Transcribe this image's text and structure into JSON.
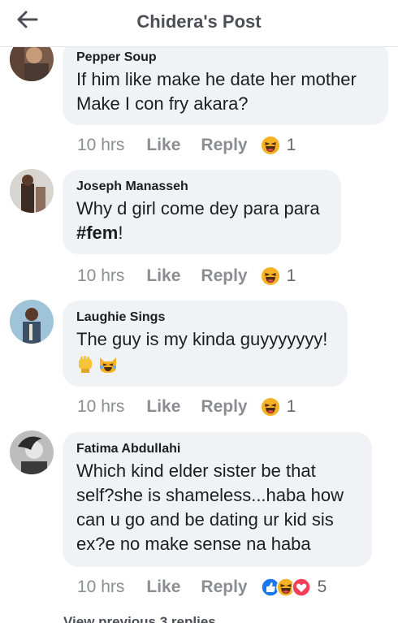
{
  "header": {
    "title": "Chidera's Post"
  },
  "comments": [
    {
      "author": "Pepper Soup",
      "text": "If him like make he date her mother\nMake I con fry akara?",
      "time": "10 hrs",
      "like": "Like",
      "reply": "Reply",
      "reactions": [
        "haha"
      ],
      "reaction_count": "1"
    },
    {
      "author": "Joseph Manasseh",
      "text_pre": "Why d girl come dey para para\n",
      "tag": "#fem",
      "text_post": "!",
      "time": "10 hrs",
      "like": "Like",
      "reply": "Reply",
      "reactions": [
        "haha"
      ],
      "reaction_count": "1"
    },
    {
      "author": "Laughie Sings",
      "text": "The guy is my kinda guyyyyyyy!",
      "emojis": [
        "raised-fist",
        "joy-cat"
      ],
      "time": "10 hrs",
      "like": "Like",
      "reply": "Reply",
      "reactions": [
        "haha"
      ],
      "reaction_count": "1"
    },
    {
      "author": "Fatima Abdullahi",
      "text": "Which kind elder sister be that\nself?she is shameless...haba how\ncan u go and be dating ur kid sis\nex?e no make sense na haba",
      "time": "10 hrs",
      "like": "Like",
      "reply": "Reply",
      "reactions": [
        "like",
        "haha",
        "love"
      ],
      "reaction_count": "5"
    }
  ],
  "view_previous": "View previous 3 replies",
  "colors": {
    "bubble": "#f0f2f5",
    "meta": "#8a8d91",
    "like_blue": "#1877f2",
    "love_red": "#f33e58",
    "haha_yellow": "#f7b125"
  }
}
